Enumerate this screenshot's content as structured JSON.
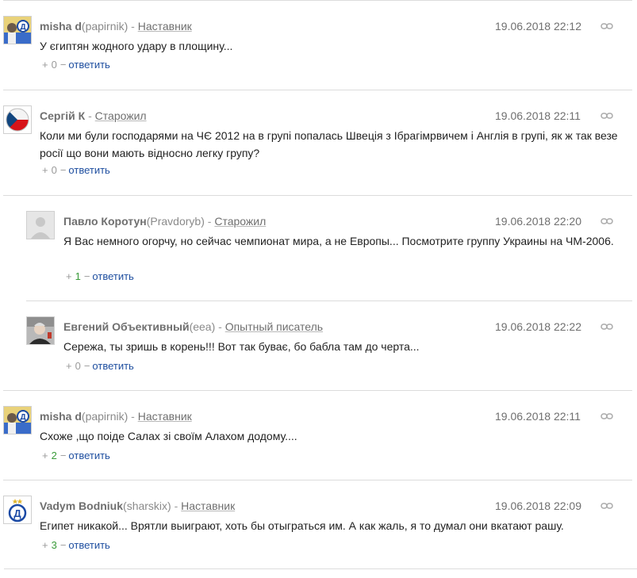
{
  "comments": [
    {
      "author": "misha d",
      "nick": "(papirnik)",
      "sep": " - ",
      "rank": "Наставник",
      "date": "19.06.2018 22:12",
      "text": "У єгиптян жодного удару в площину...",
      "score": "0",
      "reply": "ответить",
      "avatar": "dynamo-fan-avatar"
    },
    {
      "author": "Сергій К",
      "nick": "",
      "sep": " - ",
      "rank": "Старожил",
      "date": "19.06.2018 22:11",
      "text": "Коли ми були господарями на ЧЄ 2012 на в групі попалась Швеція з Ібрагімрвичем і Англія в групі, як ж так везе росії що вони мають відносно легку групу?",
      "score": "0",
      "reply": "ответить",
      "avatar": "czech-flag-avatar"
    },
    {
      "author": "Павло Коротун",
      "nick": "(Pravdoryb)",
      "sep": " - ",
      "rank": "Старожил",
      "date": "19.06.2018 22:20",
      "text": "Я Вас немного огорчу, но сейчас чемпионат мира, а не Европы... Посмотрите группу Украины на ЧМ-2006.",
      "score": "1",
      "reply": "ответить",
      "avatar": "default-avatar"
    },
    {
      "author": "Евгений Объективный",
      "nick": "(eea)",
      "sep": " - ",
      "rank": "Опытный писатель",
      "date": "19.06.2018 22:22",
      "text": "Сережа, ты зришь в корень!!! Вот так буває, бо бабла там до черта...",
      "score": "0",
      "reply": "ответить",
      "avatar": "photo-avatar"
    },
    {
      "author": "misha d",
      "nick": "(papirnik)",
      "sep": " - ",
      "rank": "Наставник",
      "date": "19.06.2018 22:11",
      "text": "Схоже ,що поіде Салах зі своїм Алахом додому....",
      "score": "2",
      "reply": "ответить",
      "avatar": "dynamo-fan-avatar"
    },
    {
      "author": "Vadym Bodniuk",
      "nick": "(sharskix)",
      "sep": " - ",
      "rank": "Наставник",
      "date": "19.06.2018 22:09",
      "text": "Египет никакой... Врятли выиграют, хоть бы отыграться им. А как жаль, я то думал они вкатают рашу.",
      "score": "3",
      "reply": "ответить",
      "avatar": "dynamo-logo-avatar"
    }
  ],
  "colors": {
    "author": "#6f6f6f",
    "reply_link": "#1f4fa0",
    "positive_score": "#3a9b3a",
    "divider": "#dcdcdc"
  }
}
